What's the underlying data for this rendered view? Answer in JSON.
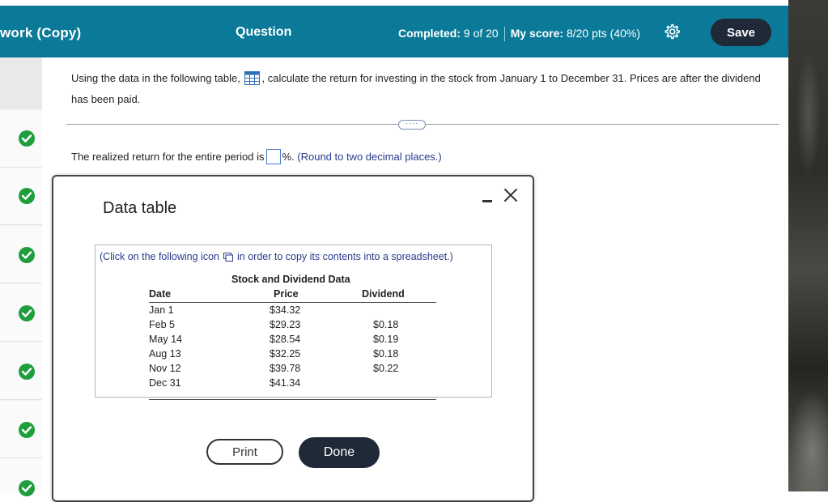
{
  "header": {
    "title": "work (Copy)",
    "question_label": "Question",
    "completed_label": "Completed:",
    "completed_value": "9 of 20",
    "score_label": "My score:",
    "score_value": "8/20 pts (40%)",
    "settings_icon": "gear-icon",
    "save_label": "Save",
    "bar_color": "#0b7a98"
  },
  "sidebar": {
    "items": [
      {
        "status": "correct",
        "icon": "check-circle-icon"
      },
      {
        "status": "correct",
        "icon": "check-circle-icon"
      },
      {
        "status": "correct",
        "icon": "check-circle-icon"
      },
      {
        "status": "correct",
        "icon": "check-circle-icon"
      },
      {
        "status": "correct",
        "icon": "check-circle-icon"
      },
      {
        "status": "correct",
        "icon": "check-circle-icon"
      },
      {
        "status": "correct",
        "icon": "check-circle-icon"
      }
    ],
    "check_color": "#1e9e3c"
  },
  "question": {
    "text_before_icon": "Using the data in the following table,",
    "text_after_icon": ", calculate the return for investing in the stock from January 1 to December 31. Prices are after the dividend has been paid.",
    "more_label": "····",
    "answer_prefix": "The realized return for the entire period is",
    "answer_value": "",
    "answer_suffix": "%.",
    "answer_hint": "(Round to two decimal places.)"
  },
  "modal": {
    "title": "Data table",
    "copy_note_before": "(Click on the following icon",
    "copy_note_after": "in order to copy its contents into a spreadsheet.)",
    "table_caption": "Stock and Dividend Data",
    "columns": [
      "Date",
      "Price",
      "Dividend"
    ],
    "rows": [
      {
        "date": "Jan 1",
        "price": "$34.32",
        "dividend": ""
      },
      {
        "date": "Feb 5",
        "price": "$29.23",
        "dividend": "$0.18"
      },
      {
        "date": "May 14",
        "price": "$28.54",
        "dividend": "$0.19"
      },
      {
        "date": "Aug 13",
        "price": "$32.25",
        "dividend": "$0.18"
      },
      {
        "date": "Nov 12",
        "price": "$39.78",
        "dividend": "$0.22"
      },
      {
        "date": "Dec 31",
        "price": "$41.34",
        "dividend": ""
      }
    ],
    "print_label": "Print",
    "done_label": "Done"
  }
}
